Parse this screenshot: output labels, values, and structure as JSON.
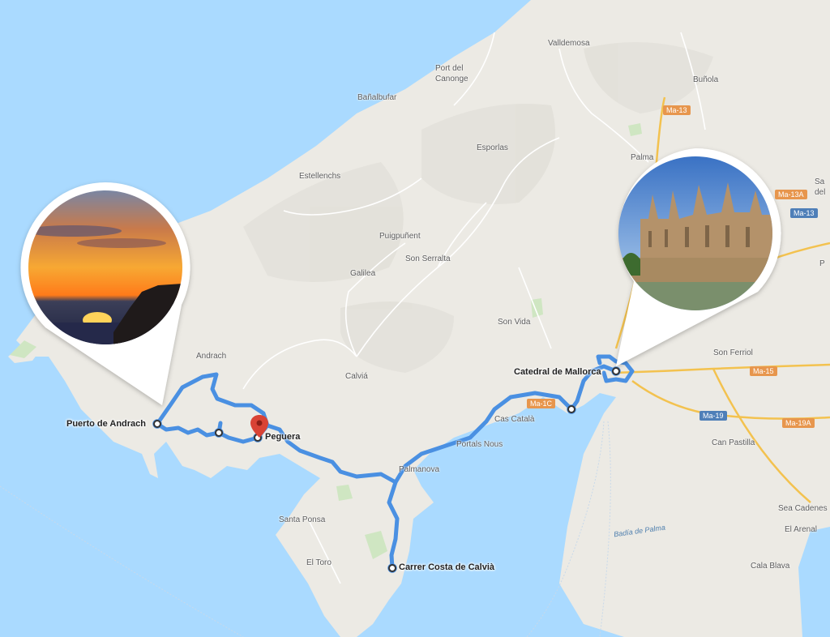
{
  "places": {
    "valldemossa": "Valldemosa",
    "port_canonge": "Port del\nCanonge",
    "bunola": "Buñola",
    "banyalbufar": "Bañalbufar",
    "esporles": "Esporlas",
    "palma": "Palma",
    "sant_marcal": "Sa\ndel",
    "estellencs": "Estellenchs",
    "puigpunyent": "Puigpuñent",
    "son_serralta": "Son Serralta",
    "galilea": "Galilea",
    "son_vida": "Son Vida",
    "andratx": "Andrach",
    "calvia": "Calviá",
    "son_ferriol": "Son Ferriol",
    "cas_catala": "Cas Català",
    "portals_nous": "Portals Nous",
    "palmanova": "Palmanova",
    "santa_ponsa": "Santa Ponsa",
    "el_toro": "El Toro",
    "can_pastilla": "Can Pastilla",
    "sea_cadenes": "Sea Cadenes",
    "el_arenal": "El Arenal",
    "cala_blava": "Cala Blava",
    "p_edge": "P"
  },
  "water": {
    "bay": "Badía de Palma"
  },
  "roads": {
    "ma13_top": "Ma-13",
    "ma13a": "Ma-13A",
    "ma13": "Ma-13",
    "ma15": "Ma-15",
    "ma1c": "Ma-1C",
    "ma19": "Ma-19",
    "ma19a": "Ma-19A"
  },
  "stops": {
    "puerto_andratx": "Puerto de Andrach",
    "peguera": "Peguera",
    "catedral": "Catedral de Mallorca",
    "costa_calvia": "Carrer Costa de Calvià"
  },
  "colors": {
    "water": "#aadaff",
    "land": "#eceae4",
    "route": "#4a90e2",
    "highway": "#f3c24f",
    "pin": "#d94335"
  },
  "callouts": {
    "left": {
      "photo": "sunset over sea cliffs"
    },
    "right": {
      "photo": "Palma cathedral"
    }
  }
}
